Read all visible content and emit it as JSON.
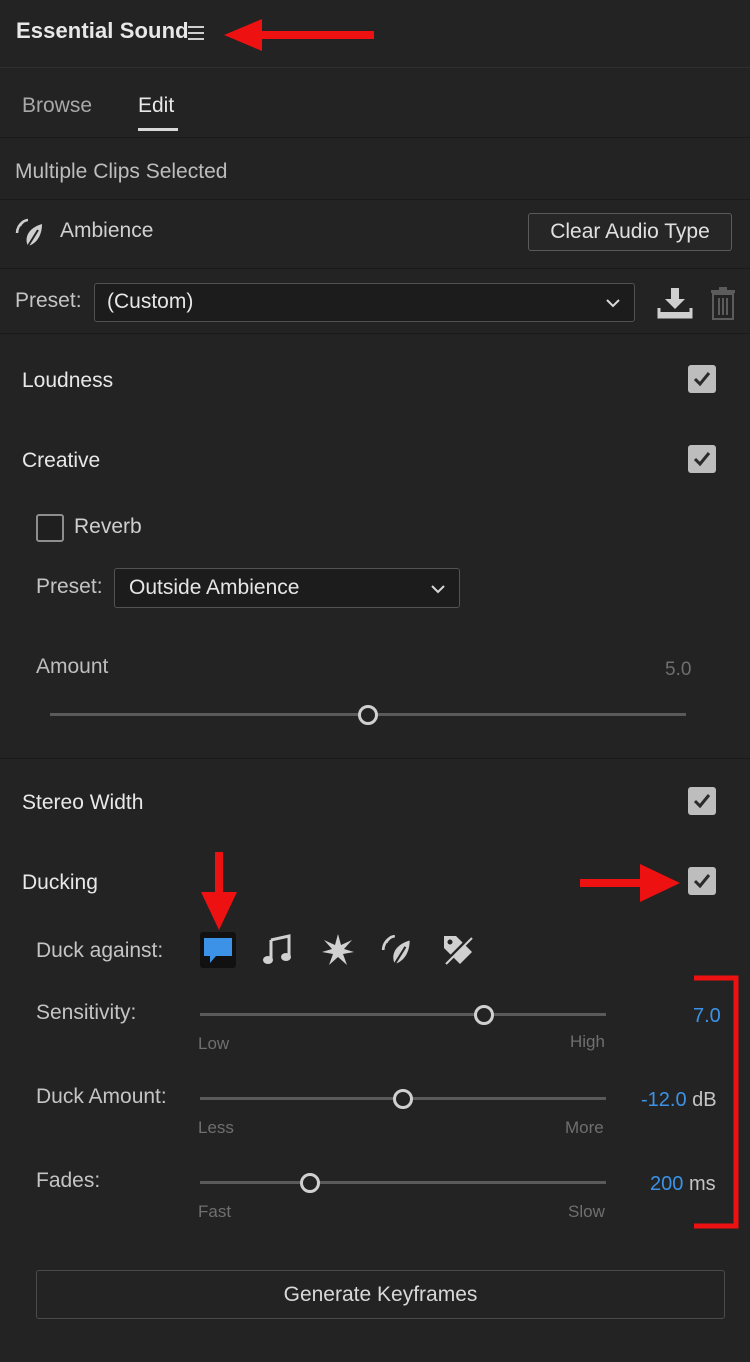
{
  "panel": {
    "title": "Essential Sound",
    "menu_icon": "hamburger-menu-icon"
  },
  "tabs": [
    {
      "label": "Browse"
    },
    {
      "label": "Edit",
      "active": true
    }
  ],
  "selection_text": "Multiple Clips Selected",
  "audio_type": {
    "icon": "ambience-leaf-icon",
    "label": "Ambience",
    "clear_button": "Clear Audio Type"
  },
  "preset": {
    "label": "Preset:",
    "value": "(Custom)",
    "save_icon": "save-preset-icon",
    "delete_icon": "trash-icon"
  },
  "sections": {
    "loudness": {
      "label": "Loudness",
      "checked": true
    },
    "creative": {
      "label": "Creative",
      "checked": true
    },
    "stereo_width": {
      "label": "Stereo Width",
      "checked": true
    },
    "ducking": {
      "label": "Ducking",
      "checked": true
    }
  },
  "creative": {
    "reverb_label": "Reverb",
    "reverb_checked": false,
    "preset_label": "Preset:",
    "preset_value": "Outside Ambience",
    "amount_label": "Amount",
    "amount_value": "5.0",
    "amount_fraction": 0.5
  },
  "ducking": {
    "duck_against_label": "Duck against:",
    "duck_against_icons": [
      "dialogue-bubble-icon",
      "music-note-icon",
      "sfx-burst-icon",
      "ambience-leaf-icon",
      "auto-tag-icon"
    ],
    "selected_icon": "dialogue-bubble-icon",
    "sensitivity": {
      "label": "Sensitivity:",
      "value": "7.0",
      "low": "Low",
      "high": "High",
      "fraction": 0.7
    },
    "duck_amount": {
      "label": "Duck Amount:",
      "value": "-12.0",
      "unit": "dB",
      "low": "Less",
      "high": "More",
      "fraction": 0.5
    },
    "fades": {
      "label": "Fades:",
      "value": "200",
      "unit": "ms",
      "low": "Fast",
      "high": "Slow",
      "fraction": 0.27
    }
  },
  "generate_button": "Generate Keyframes",
  "colors": {
    "accent_blue": "#3b92e6",
    "annotation_red": "#ee1111",
    "panel_bg": "#232323"
  }
}
